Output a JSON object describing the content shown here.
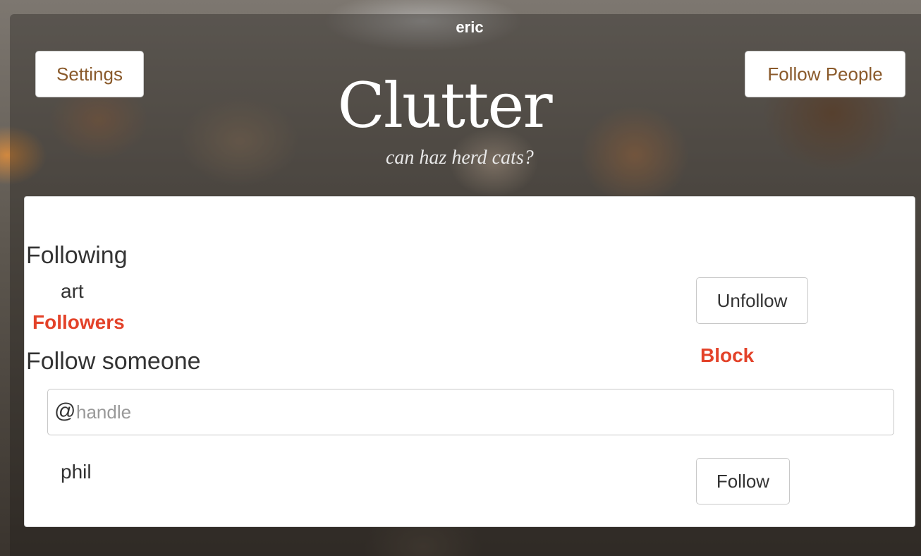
{
  "header": {
    "username": "eric",
    "settings_label": "Settings",
    "follow_people_label": "Follow People",
    "brand_title": "Clutter",
    "brand_tagline": "can haz herd cats?"
  },
  "panel": {
    "following_heading": "Following",
    "following": [
      {
        "name": "art",
        "action_label": "Unfollow"
      }
    ],
    "followers_label": "Followers",
    "block_label": "Block",
    "follow_someone_heading": "Follow someone",
    "handle_prefix": "@",
    "handle_placeholder": "handle",
    "handle_value": "",
    "suggestions": [
      {
        "name": "phil",
        "action_label": "Follow"
      }
    ]
  },
  "colors": {
    "accent_brown": "#8a5a2b",
    "link_red": "#e34229"
  }
}
